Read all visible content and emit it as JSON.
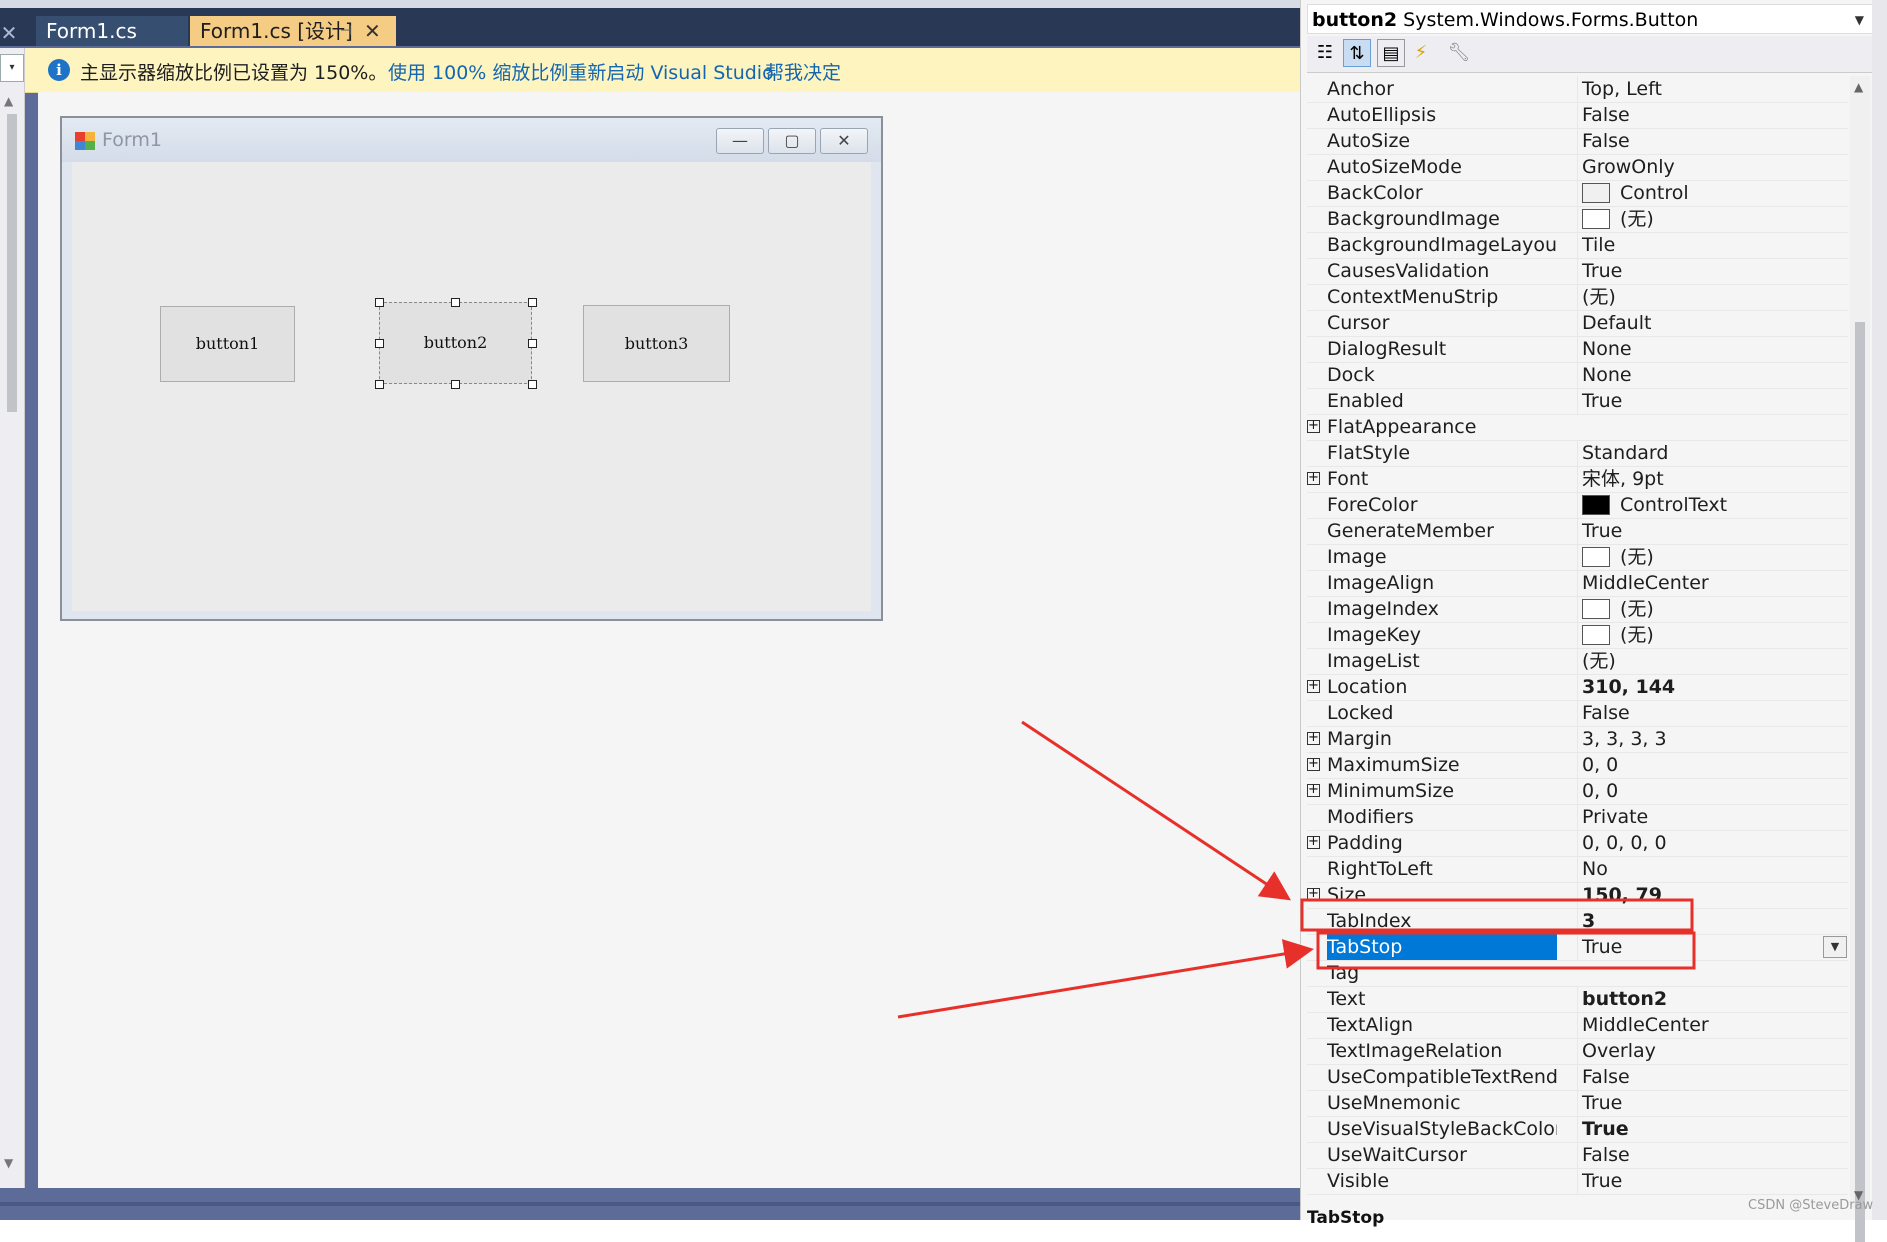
{
  "ide": {
    "tabs": [
      {
        "label": "Form1.cs"
      },
      {
        "label": "Form1.cs [设计]"
      }
    ],
    "infobar": {
      "message": "主显示器缩放比例已设置为 150%。",
      "link_restart": "使用 100% 缩放比例重新启动 Visual Studio",
      "link_decide": "帮我决定"
    }
  },
  "form": {
    "title": "Form1",
    "buttons": [
      {
        "label": "button1"
      },
      {
        "label": "button2"
      },
      {
        "label": "button3"
      }
    ]
  },
  "properties": {
    "object_name": "button2",
    "object_type": "System.Windows.Forms.Button",
    "rows": [
      {
        "name": "Anchor",
        "value": "Top, Left"
      },
      {
        "name": "AutoEllipsis",
        "value": "False"
      },
      {
        "name": "AutoSize",
        "value": "False"
      },
      {
        "name": "AutoSizeMode",
        "value": "GrowOnly"
      },
      {
        "name": "BackColor",
        "value": "Control",
        "swatch": "#f0f0f0"
      },
      {
        "name": "BackgroundImage",
        "value": "(无)",
        "swatch": "#ffffff"
      },
      {
        "name": "BackgroundImageLayout",
        "value": "Tile"
      },
      {
        "name": "CausesValidation",
        "value": "True"
      },
      {
        "name": "ContextMenuStrip",
        "value": "(无)"
      },
      {
        "name": "Cursor",
        "value": "Default"
      },
      {
        "name": "DialogResult",
        "value": "None"
      },
      {
        "name": "Dock",
        "value": "None"
      },
      {
        "name": "Enabled",
        "value": "True"
      },
      {
        "name": "FlatAppearance",
        "value": "",
        "expandable": true
      },
      {
        "name": "FlatStyle",
        "value": "Standard"
      },
      {
        "name": "Font",
        "value": "宋体, 9pt",
        "expandable": true
      },
      {
        "name": "ForeColor",
        "value": "ControlText",
        "swatch": "#000000"
      },
      {
        "name": "GenerateMember",
        "value": "True"
      },
      {
        "name": "Image",
        "value": "(无)",
        "swatch": "#ffffff"
      },
      {
        "name": "ImageAlign",
        "value": "MiddleCenter"
      },
      {
        "name": "ImageIndex",
        "value": "(无)",
        "swatch": "#ffffff"
      },
      {
        "name": "ImageKey",
        "value": "(无)",
        "swatch": "#ffffff"
      },
      {
        "name": "ImageList",
        "value": "(无)"
      },
      {
        "name": "Location",
        "value": "310, 144",
        "expandable": true,
        "bold": true
      },
      {
        "name": "Locked",
        "value": "False"
      },
      {
        "name": "Margin",
        "value": "3, 3, 3, 3",
        "expandable": true
      },
      {
        "name": "MaximumSize",
        "value": "0, 0",
        "expandable": true
      },
      {
        "name": "MinimumSize",
        "value": "0, 0",
        "expandable": true
      },
      {
        "name": "Modifiers",
        "value": "Private"
      },
      {
        "name": "Padding",
        "value": "0, 0, 0, 0",
        "expandable": true
      },
      {
        "name": "RightToLeft",
        "value": "No"
      },
      {
        "name": "Size",
        "value": "150, 79",
        "expandable": true,
        "bold": true
      },
      {
        "name": "TabIndex",
        "value": "3",
        "bold": true
      },
      {
        "name": "TabStop",
        "value": "True",
        "selected": true
      },
      {
        "name": "Tag",
        "value": ""
      },
      {
        "name": "Text",
        "value": "button2",
        "bold": true
      },
      {
        "name": "TextAlign",
        "value": "MiddleCenter"
      },
      {
        "name": "TextImageRelation",
        "value": "Overlay"
      },
      {
        "name": "UseCompatibleTextRenderin",
        "value": "False"
      },
      {
        "name": "UseMnemonic",
        "value": "True"
      },
      {
        "name": "UseVisualStyleBackColor",
        "value": "True",
        "bold": true
      },
      {
        "name": "UseWaitCursor",
        "value": "False"
      },
      {
        "name": "Visible",
        "value": "True"
      }
    ],
    "description_title": "TabStop"
  },
  "watermark": "CSDN @SteveDraw",
  "colors": {
    "annotation_red": "#e8302a",
    "selection_blue": "#0078d7",
    "active_tab": "#f5cc84"
  }
}
